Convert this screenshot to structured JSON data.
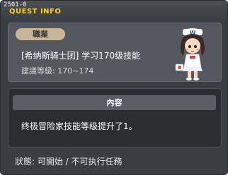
{
  "window": {
    "quest_id": "2501-0",
    "title": "QUEST INFO"
  },
  "quest": {
    "category": "職業",
    "title": "[希纳斯骑士团] 学习170级技能",
    "level_requirement": "建議等級: 170~174"
  },
  "content": {
    "header": "內容",
    "text": "终极冒险家技能等级提升了1。"
  },
  "status": {
    "text": "狀態: 可開始 / 不可执行任務"
  },
  "colors": {
    "title_yellow": "#ffd21f",
    "badge_bg": "#c8b49b",
    "window_bg": "#3a3d42"
  }
}
